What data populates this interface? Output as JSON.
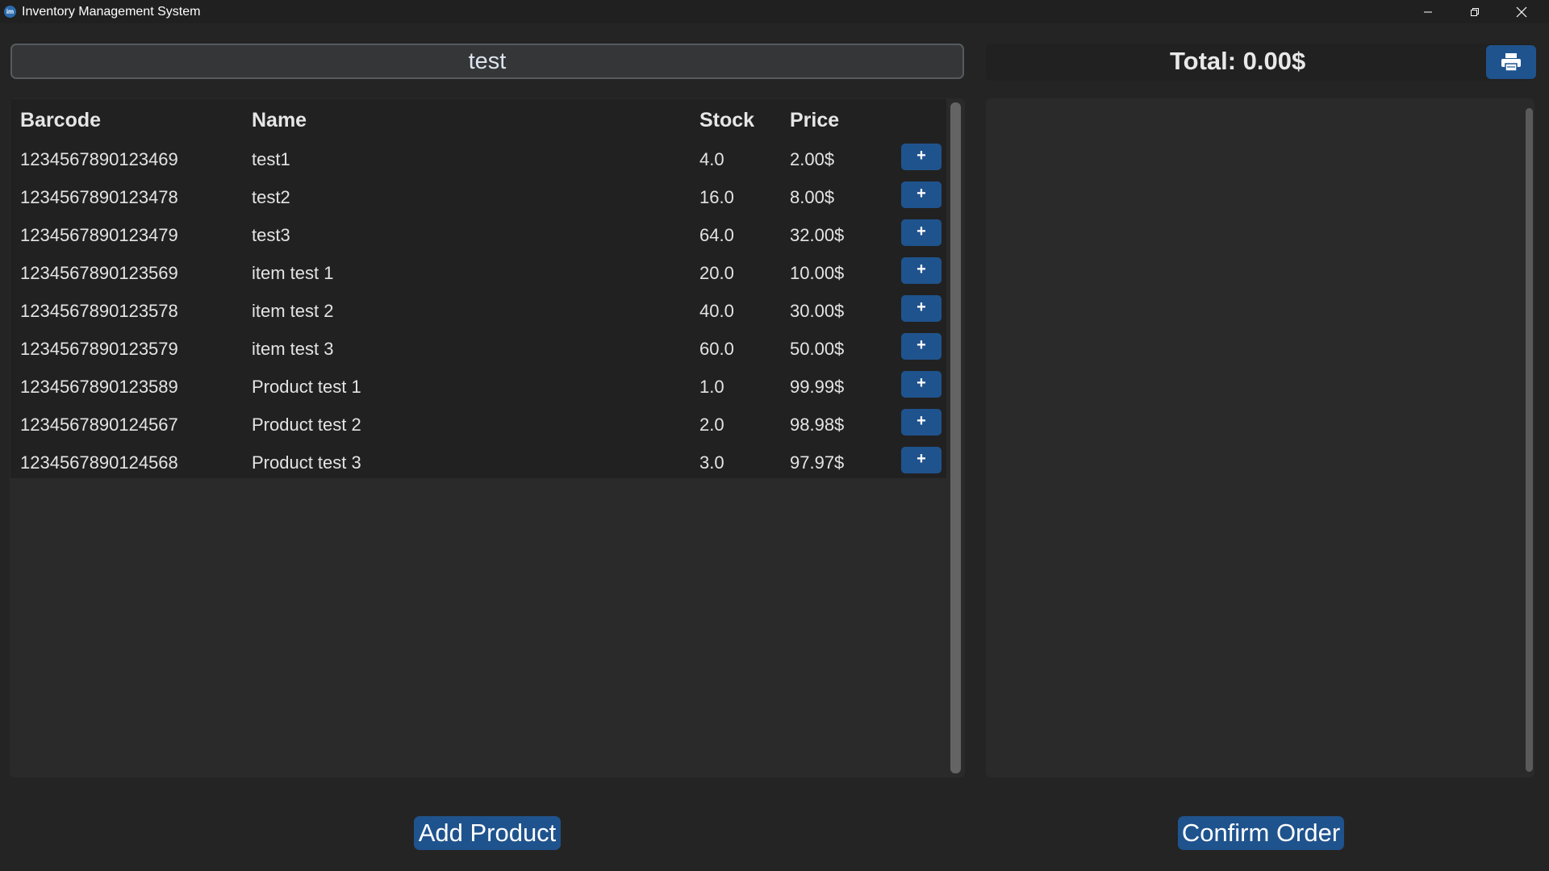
{
  "window": {
    "title": "Inventory Management System",
    "icon": "app-icon",
    "icon_text": "im",
    "controls": [
      "minimize-icon",
      "restore-icon",
      "close-icon"
    ]
  },
  "search": {
    "value": "test"
  },
  "table": {
    "headers": [
      "Barcode",
      "Name",
      "Stock",
      "Price"
    ],
    "add_button_label": "+",
    "rows": [
      {
        "barcode": "1234567890123469",
        "name": "test1",
        "stock": "4.0",
        "price": "2.00$"
      },
      {
        "barcode": "1234567890123478",
        "name": "test2",
        "stock": "16.0",
        "price": "8.00$"
      },
      {
        "barcode": "1234567890123479",
        "name": "test3",
        "stock": "64.0",
        "price": "32.00$"
      },
      {
        "barcode": "1234567890123569",
        "name": "item test 1",
        "stock": "20.0",
        "price": "10.00$"
      },
      {
        "barcode": "1234567890123578",
        "name": "item test 2",
        "stock": "40.0",
        "price": "30.00$"
      },
      {
        "barcode": "1234567890123579",
        "name": "item test 3",
        "stock": "60.0",
        "price": "50.00$"
      },
      {
        "barcode": "1234567890123589",
        "name": "Product test 1",
        "stock": "1.0",
        "price": "99.99$"
      },
      {
        "barcode": "1234567890124567",
        "name": "Product test 2",
        "stock": "2.0",
        "price": "98.98$"
      },
      {
        "barcode": "1234567890124568",
        "name": "Product test 3",
        "stock": "3.0",
        "price": "97.97$"
      }
    ]
  },
  "order": {
    "total_label": "Total: 0.00$",
    "print_icon": "printer-icon"
  },
  "buttons": {
    "add_product": "Add Product",
    "confirm_order": "Confirm Order"
  },
  "colors": {
    "accent": "#1f538d",
    "background": "#242424",
    "panel": "#2a2a2a",
    "table": "#212121",
    "text": "#dce4ee"
  }
}
